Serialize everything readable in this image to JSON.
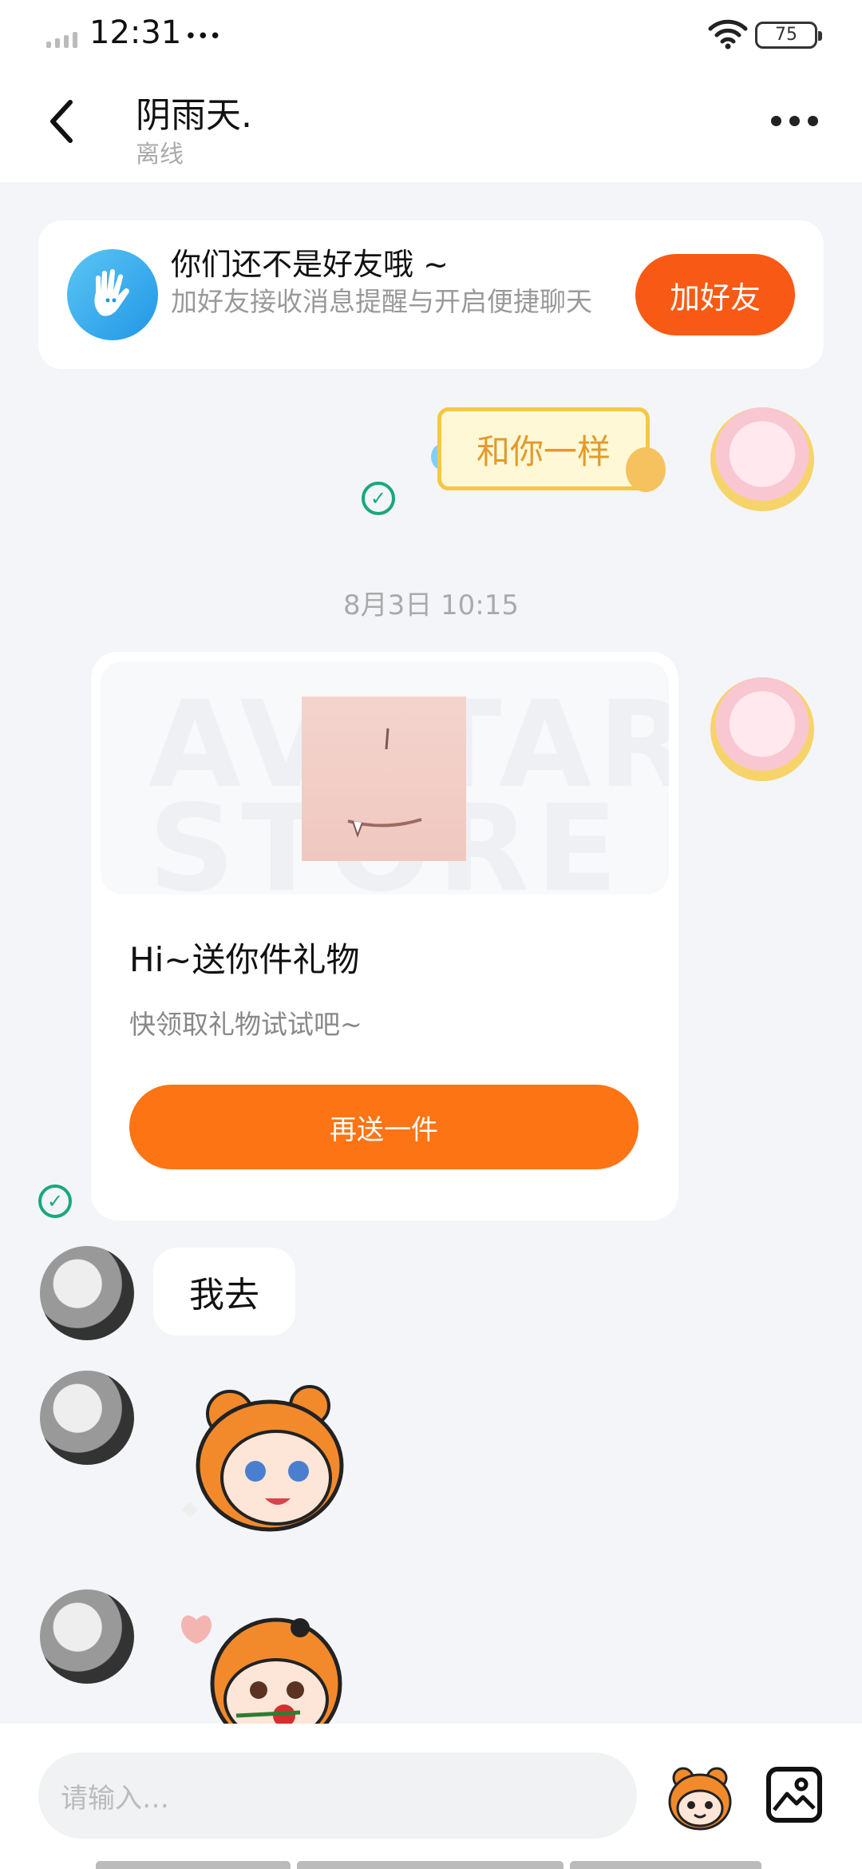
{
  "status_bar": {
    "time": "12:31",
    "time_suffix": "•••",
    "battery": "75"
  },
  "header": {
    "title": "阴雨天.",
    "status": "离线"
  },
  "friend_banner": {
    "title": "你们还不是好友哦 ~",
    "subtitle": "加好友接收消息提醒与开启便捷聊天",
    "button": "加好友"
  },
  "messages": {
    "sent_sticker_text": "和你一样",
    "timestamp": "8月3日 10:15",
    "gift_card": {
      "watermark": "AVATAR STORE",
      "title": "Hi~送你件礼物",
      "subtitle": "快领取礼物试试吧~",
      "button": "再送一件"
    },
    "incoming_text": "我去"
  },
  "input_bar": {
    "placeholder": "请输入…"
  },
  "colors": {
    "accent": "#f85a15",
    "gift_button": "#fd7414",
    "check": "#1aa879",
    "background": "#f3f5f9"
  }
}
